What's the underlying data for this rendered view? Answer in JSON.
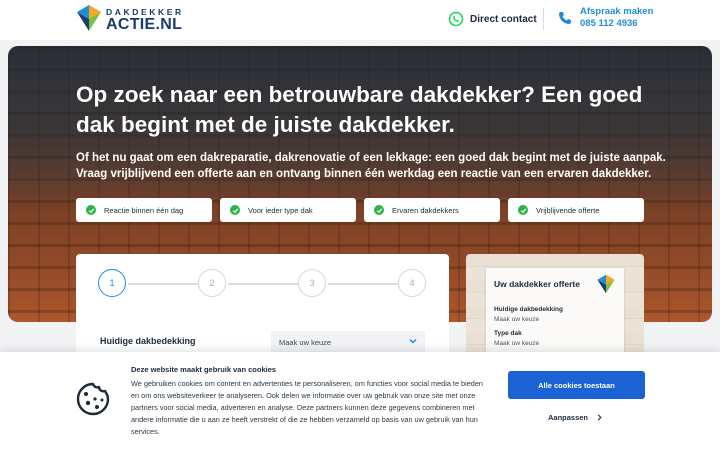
{
  "header": {
    "logo_top": "DAKDEKKER",
    "logo_main": "ACTIE.NL",
    "contact_label": "Direct contact",
    "phone_line1": "Afspraak maken",
    "phone_line2": "085 112 4936"
  },
  "hero": {
    "title": "Op zoek naar een betrouwbare dakdekker? Een goed dak begint met de juiste dakdekker.",
    "subtitle": "Of het nu gaat om een dakreparatie, dakrenovatie of een lekkage: een goed dak begint met de juiste aanpak. Vraag vrijblijvend een offerte aan en ontvang binnen één werkdag een reactie van een ervaren dakdekker.",
    "usps": [
      {
        "label": "Reactie binnen één dag"
      },
      {
        "label": "Voor ieder type dak"
      },
      {
        "label": "Ervaren dakdekkers"
      },
      {
        "label": "Vrijblijvende offerte"
      }
    ]
  },
  "form": {
    "steps": [
      "1",
      "2",
      "3",
      "4"
    ],
    "active_step": 1,
    "field_label": "Huidige dakbedekking",
    "select_value": "Maak uw keuze"
  },
  "offerte": {
    "title": "Uw dakdekker offerte",
    "rows": [
      {
        "label": "Huidige dakbedekking",
        "value": "Maak uw keuze"
      },
      {
        "label": "Type dak",
        "value": "Maak uw keuze"
      }
    ]
  },
  "cookie": {
    "title": "Deze website maakt gebruik van cookies",
    "text": "We gebruiken cookies om content en advertenties te personaliseren, om functies voor social media te bieden en om ons websiteverkeer te analyseren. Ook delen we informatie over uw gebruik van onze site met onze partners voor social media, adverteren en analyse. Deze partners kunnen deze gegevens combineren met andere informatie die u aan ze heeft verstrekt of die ze hebben verzameld op basis van uw gebruik van hun services.",
    "accept_label": "Alle cookies toestaan",
    "adjust_label": "Aanpassen"
  },
  "colors": {
    "accent_blue": "#1e8fd5",
    "button_blue": "#1b63d4",
    "check_green": "#2cb34a",
    "whatsapp_green": "#25d366"
  }
}
